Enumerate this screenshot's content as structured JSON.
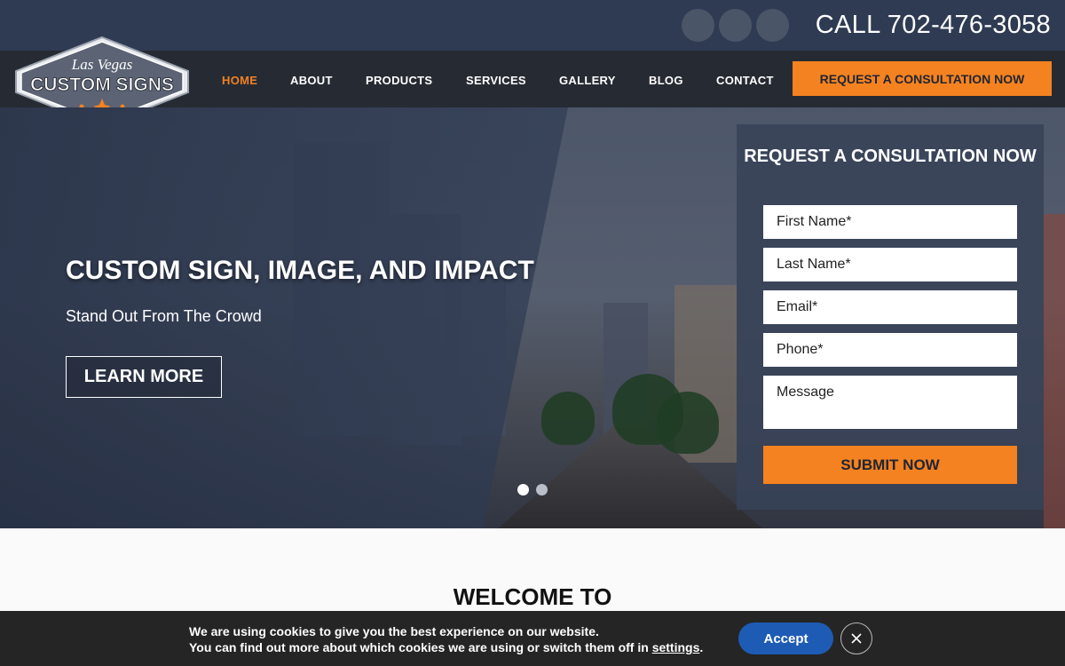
{
  "topbar": {
    "call_text": "CALL 702-476-3058",
    "social_icons": [
      "social-icon",
      "social-icon",
      "social-icon"
    ]
  },
  "logo": {
    "script_text": "Las Vegas",
    "main_text": "CUSTOM SIGNS"
  },
  "nav": {
    "items": [
      {
        "label": "HOME",
        "active": true
      },
      {
        "label": "ABOUT"
      },
      {
        "label": "PRODUCTS"
      },
      {
        "label": "SERVICES"
      },
      {
        "label": "GALLERY"
      },
      {
        "label": "BLOG"
      },
      {
        "label": "CONTACT"
      }
    ],
    "cta_label": "REQUEST A CONSULTATION NOW"
  },
  "hero": {
    "title": "CUSTOM SIGN, IMAGE, AND IMPACT",
    "subtitle": "Stand Out From The Crowd",
    "button_label": "LEARN MORE",
    "slide_count": 2,
    "active_slide": 1
  },
  "form": {
    "title": "REQUEST A CONSULTATION NOW",
    "first_name_placeholder": "First Name*",
    "last_name_placeholder": "Last Name*",
    "email_placeholder": "Email*",
    "phone_placeholder": "Phone*",
    "message_placeholder": "Message",
    "submit_label": "SUBMIT NOW"
  },
  "welcome": {
    "heading": "WELCOME TO"
  },
  "cookie": {
    "line1": "We are using cookies to give you the best experience on our website.",
    "line2_prefix": "You can find out more about which cookies we are using or switch them off in ",
    "settings_link": "settings",
    "line2_suffix": ".",
    "accept_label": "Accept",
    "close_icon": "close-icon"
  },
  "colors": {
    "accent": "#f58220",
    "nav_bg": "#262b33",
    "topbar_bg": "#2f3b52",
    "accept_blue": "#1e5bb4"
  }
}
